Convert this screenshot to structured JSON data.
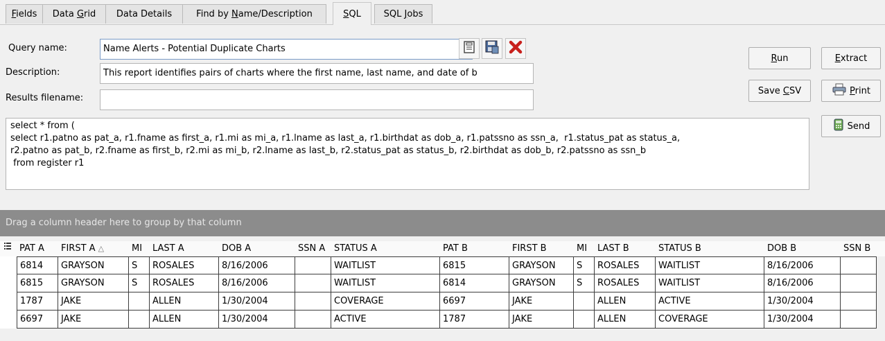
{
  "tabs": [
    {
      "label": "Fields",
      "key": "F",
      "rest": "ields",
      "pre": ""
    },
    {
      "label": "Data Grid",
      "pre": "Data ",
      "key": "G",
      "rest": "rid"
    },
    {
      "label": "Data Details",
      "pre": "Data Details",
      "key": "",
      "rest": ""
    },
    {
      "label": "Find by Name/Description",
      "pre": "Find by ",
      "key": "N",
      "rest": "ame/Description"
    },
    {
      "label": "SQL",
      "pre": "",
      "key": "S",
      "rest": "QL"
    },
    {
      "label": "SQL Jobs",
      "pre": "SQL ",
      "key": "J",
      "rest": "obs"
    }
  ],
  "form": {
    "query_name_label": "Query name:",
    "query_name_value": "Name Alerts - Potential Duplicate Charts",
    "description_label": "Description:",
    "description_value": "This report identifies pairs of charts where the first name, last name, and date of b",
    "results_filename_label": "Results filename:",
    "results_filename_value": ""
  },
  "icons": [
    "save-icon",
    "save-as-icon",
    "delete-icon",
    "printer-icon",
    "send-icon",
    "chevron-down-icon"
  ],
  "buttons": {
    "run": {
      "pre": "",
      "key": "R",
      "rest": "un"
    },
    "extract": {
      "pre": "",
      "key": "E",
      "rest": "xtract"
    },
    "save_csv": {
      "pre": "Save ",
      "key": "C",
      "rest": "SV"
    },
    "print": {
      "pre": "",
      "key": "P",
      "rest": "rint"
    },
    "send": {
      "pre": "Send",
      "key": "",
      "rest": ""
    }
  },
  "sql_text": "select * from (\nselect r1.patno as pat_a, r1.fname as first_a, r1.mi as mi_a, r1.lname as last_a, r1.birthdat as dob_a, r1.patssno as ssn_a,  r1.status_pat as status_a,\nr2.patno as pat_b, r2.fname as first_b, r2.mi as mi_b, r2.lname as last_b, r2.status_pat as status_b, r2.birthdat as dob_b, r2.patssno as ssn_b\n from register r1",
  "group_hint": "Drag a column header here to group by that column",
  "grid": {
    "columns": [
      "PAT A",
      "FIRST A",
      "MI",
      "LAST A",
      "DOB A",
      "SSN A",
      "STATUS A",
      "PAT B",
      "FIRST B",
      "MI",
      "LAST B",
      "STATUS B",
      "DOB B",
      "SSN B"
    ],
    "sorted_column": "FIRST A",
    "rows": [
      [
        "6814",
        "GRAYSON",
        "S",
        "ROSALES",
        "8/16/2006",
        "",
        "WAITLIST",
        "6815",
        "GRAYSON",
        "S",
        "ROSALES",
        "WAITLIST",
        "8/16/2006",
        ""
      ],
      [
        "6815",
        "GRAYSON",
        "S",
        "ROSALES",
        "8/16/2006",
        "",
        "WAITLIST",
        "6814",
        "GRAYSON",
        "S",
        "ROSALES",
        "WAITLIST",
        "8/16/2006",
        ""
      ],
      [
        "1787",
        "JAKE",
        "",
        "ALLEN",
        "1/30/2004",
        "",
        "COVERAGE",
        "6697",
        "JAKE",
        "",
        "ALLEN",
        "ACTIVE",
        "1/30/2004",
        ""
      ],
      [
        "6697",
        "JAKE",
        "",
        "ALLEN",
        "1/30/2004",
        "",
        "ACTIVE",
        "1787",
        "JAKE",
        "",
        "ALLEN",
        "COVERAGE",
        "1/30/2004",
        ""
      ]
    ]
  }
}
